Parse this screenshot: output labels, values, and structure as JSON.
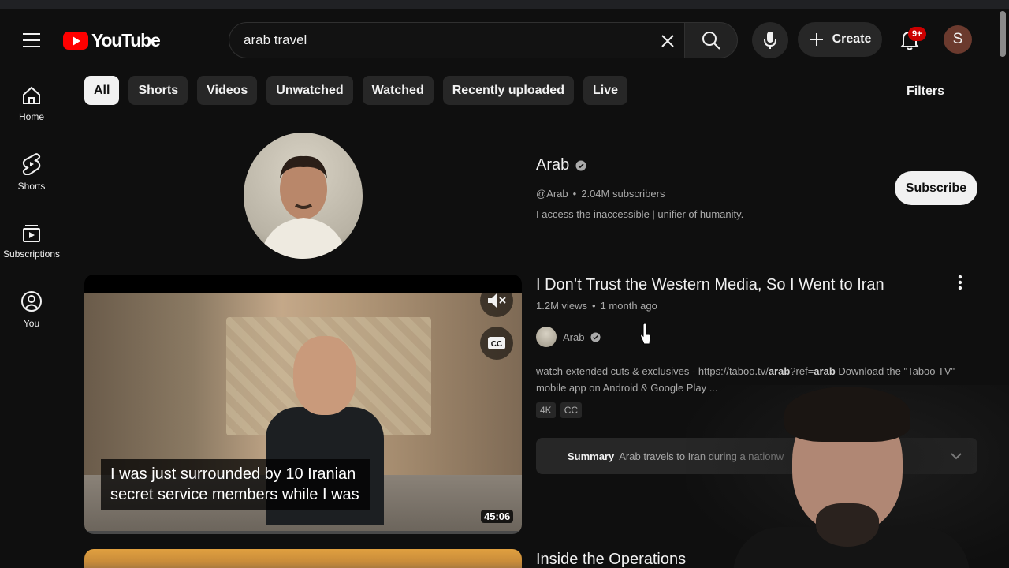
{
  "header": {
    "logo_text": "YouTube",
    "search_value": "arab travel",
    "create_label": "Create",
    "notification_count": "9+",
    "avatar_initial": "S"
  },
  "guide": {
    "items": [
      {
        "label": "Home",
        "icon": "home-icon"
      },
      {
        "label": "Shorts",
        "icon": "shorts-icon"
      },
      {
        "label": "Subscriptions",
        "icon": "subscriptions-icon"
      },
      {
        "label": "You",
        "icon": "you-icon"
      }
    ]
  },
  "chips": {
    "items": [
      "All",
      "Shorts",
      "Videos",
      "Unwatched",
      "Watched",
      "Recently uploaded",
      "Live"
    ],
    "selected": "All",
    "filters_label": "Filters"
  },
  "channel": {
    "name": "Arab",
    "handle": "@Arab",
    "subscribers": "2.04M subscribers",
    "description": "I access the inaccessible | unifier of humanity.",
    "subscribe_label": "Subscribe"
  },
  "video": {
    "title": "I Don’t Trust the Western Media, So I Went to Iran",
    "views": "1.2M views",
    "age": "1 month ago",
    "channel_name": "Arab",
    "caption_text": "I was just surrounded by 10 Iranian secret service members while I was",
    "duration": "45:06",
    "cc_label": "CC",
    "description_prefix": "watch extended cuts & exclusives - https://taboo.tv/",
    "description_bold1": "arab",
    "description_mid": "?ref=",
    "description_bold2": "arab",
    "description_suffix": " Download the \"Taboo TV\" mobile app on Android & Google Play ...",
    "badges": [
      "4K",
      "CC"
    ],
    "summary_label": "Summary",
    "summary_text": "Arab travels to Iran during a nationw"
  },
  "next_video": {
    "title": "Inside the Operations"
  },
  "colors": {
    "background": "#0f0f0f",
    "brand_red": "#ff0000",
    "chip_bg": "#272727",
    "text_primary": "#f1f1f1",
    "text_secondary": "#aaaaaa"
  }
}
